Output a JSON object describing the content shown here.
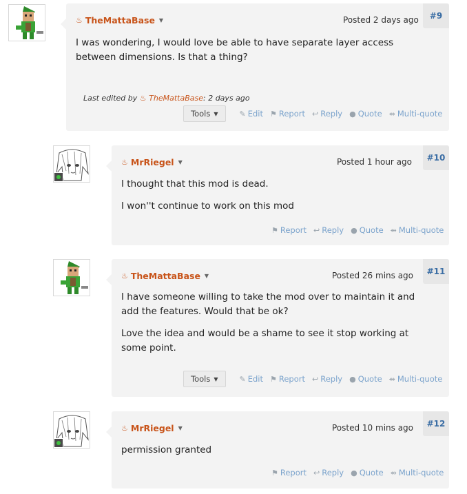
{
  "posts": [
    {
      "author": "TheMattaBase",
      "posted": "Posted 2 days ago",
      "number": "#9",
      "paragraphs": [
        "I was wondering, I would love be able to have separate layer access between dimensions. Is that a thing?"
      ],
      "edited_prefix": "Last edited by",
      "edited_author": "TheMattaBase",
      "edited_suffix": ": 2 days ago",
      "avatar": "minecraft-elf-avatar"
    },
    {
      "author": "MrRiegel",
      "posted": "Posted 1 hour ago",
      "number": "#10",
      "paragraphs": [
        "I thought that this mod is dead.",
        "I won''t continue to work on this mod"
      ],
      "avatar": "anime-sketch-avatar"
    },
    {
      "author": "TheMattaBase",
      "posted": "Posted 26 mins ago",
      "number": "#11",
      "paragraphs": [
        "I have someone willing to take the mod over to maintain it and add the features. Would that be ok?",
        "Love the idea and would be a shame to see it stop working at some point."
      ],
      "avatar": "minecraft-elf-avatar"
    },
    {
      "author": "MrRiegel",
      "posted": "Posted 10 mins ago",
      "number": "#12",
      "paragraphs": [
        "permission granted"
      ],
      "avatar": "anime-sketch-avatar"
    }
  ],
  "actions": {
    "tools": "Tools",
    "edit": "Edit",
    "report": "Report",
    "reply": "Reply",
    "quote": "Quote",
    "multiquote": "Multi-quote"
  },
  "colors": {
    "author": "#c8541a",
    "link": "#7ba3cc",
    "post_bg": "#f3f3f3",
    "number": "#3a6da4"
  }
}
